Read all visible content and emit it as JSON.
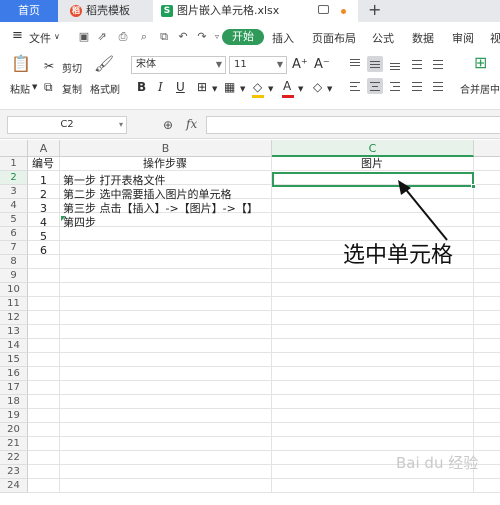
{
  "tabs": {
    "home": "首页",
    "template": "稻壳模板",
    "template_icon": "稻",
    "file": "图片嵌入单元格.xlsx",
    "file_icon": "S",
    "new_tab": "+"
  },
  "menu": {
    "hamburger": "≡",
    "file": "文件",
    "start": "开始",
    "items": [
      "插入",
      "页面布局",
      "公式",
      "数据",
      "审阅",
      "视"
    ]
  },
  "ribbon": {
    "paste": "粘贴",
    "cut": "剪切",
    "copy": "复制",
    "format_painter": "格式刷",
    "font_name": "宋体",
    "font_size": "11",
    "bold": "B",
    "italic": "I",
    "underline": "U",
    "font_color": "A",
    "grow": "A⁺",
    "shrink": "A⁻",
    "merge": "合并居中"
  },
  "formula_bar": {
    "cell_ref": "C2",
    "fx": "fx",
    "value": ""
  },
  "sheet": {
    "columns": [
      "A",
      "B",
      "C"
    ],
    "selected_column": "C",
    "rows": [
      "1",
      "2",
      "3",
      "4",
      "5",
      "6",
      "7",
      "8",
      "9",
      "10",
      "11",
      "12",
      "13",
      "14",
      "15",
      "16",
      "17",
      "18",
      "19",
      "20",
      "21",
      "22",
      "23",
      "24"
    ],
    "selected_row": "2",
    "cells": {
      "A1": "编号",
      "B1": "操作步骤",
      "C1": "图片",
      "A2": "1",
      "B2": "第一步  打开表格文件",
      "A3": "2",
      "B3": "第二步  选中需要插入图片的单元格",
      "A4": "3",
      "B4": "第三步  点击【插入】->【图片】->【】",
      "A5": "4",
      "B5": "第四步",
      "A6": "5",
      "A7": "6"
    }
  },
  "annotation": "选中单元格",
  "watermark": "Bai du 经验",
  "colors": {
    "accent": "#2f9a5a",
    "home_tab": "#3d7be8"
  }
}
